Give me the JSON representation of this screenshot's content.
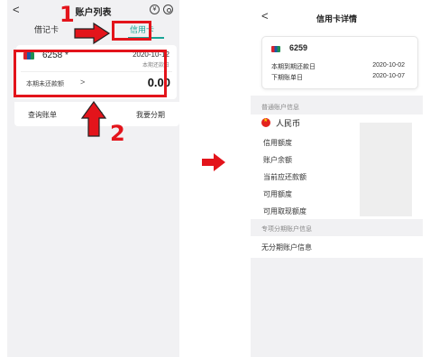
{
  "left": {
    "title": "账户列表",
    "icons": [
      "balance-icon",
      "settings-icon"
    ],
    "tabs": [
      "借记卡",
      "信用卡"
    ],
    "card": {
      "number": "6258 *",
      "due_date": "2020-10-12",
      "due_date_label": "本期还款日",
      "unpaid_label": "本期未还款额",
      "unpaid_amount": "0.00"
    },
    "actions": [
      "查询账单",
      "还款",
      "我要分期"
    ]
  },
  "annotations": {
    "step1": "1",
    "step2": "2"
  },
  "right": {
    "title": "信用卡详情",
    "card": {
      "number": "6259",
      "rows": [
        {
          "label": "本期到期还款日",
          "value": "2020-10-02"
        },
        {
          "label": "下期账单日",
          "value": "2020-10-07"
        }
      ]
    },
    "section1_title": "普通账户信息",
    "currency": "人民币",
    "info_rows": [
      "信用额度",
      "账户余额",
      "当前应还款额",
      "可用额度",
      "可用取现额度"
    ],
    "section2_title": "专项分期账户信息",
    "no_installment": "无分期账户信息"
  },
  "colors": {
    "accent": "#1aa596",
    "annotation": "#e3141b"
  }
}
